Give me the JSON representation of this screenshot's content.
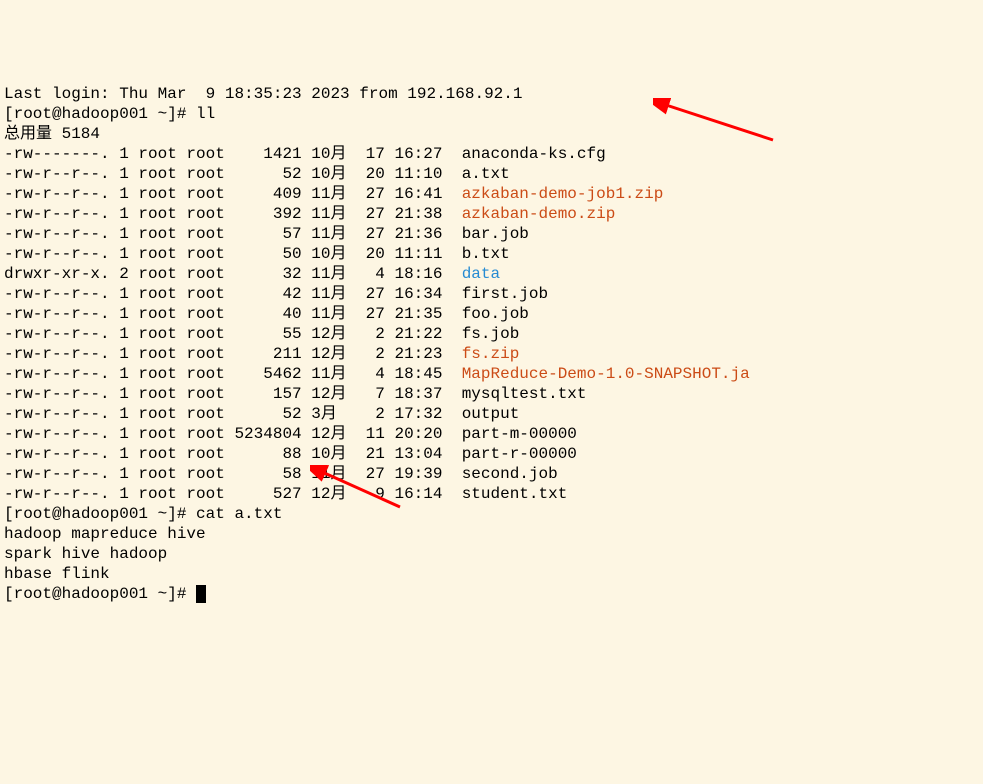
{
  "login_line": "Last login: Thu Mar  9 18:35:23 2023 from 192.168.92.1",
  "prompt1": "[root@hadoop001 ~]# ",
  "cmd1": "ll",
  "total_line": "总用量 5184",
  "files": [
    {
      "perms": "-rw-------.",
      "links": "1",
      "owner": "root",
      "group": "root",
      "size": "   1421",
      "month": "10月",
      "day": " 17",
      "time": "16:27",
      "name": "anaconda-ks.cfg",
      "color": ""
    },
    {
      "perms": "-rw-r--r--.",
      "links": "1",
      "owner": "root",
      "group": "root",
      "size": "     52",
      "month": "10月",
      "day": " 20",
      "time": "11:10",
      "name": "a.txt",
      "color": ""
    },
    {
      "perms": "-rw-r--r--.",
      "links": "1",
      "owner": "root",
      "group": "root",
      "size": "    409",
      "month": "11月",
      "day": " 27",
      "time": "16:41",
      "name": "azkaban-demo-job1.zip",
      "color": "red"
    },
    {
      "perms": "-rw-r--r--.",
      "links": "1",
      "owner": "root",
      "group": "root",
      "size": "    392",
      "month": "11月",
      "day": " 27",
      "time": "21:38",
      "name": "azkaban-demo.zip",
      "color": "red"
    },
    {
      "perms": "-rw-r--r--.",
      "links": "1",
      "owner": "root",
      "group": "root",
      "size": "     57",
      "month": "11月",
      "day": " 27",
      "time": "21:36",
      "name": "bar.job",
      "color": ""
    },
    {
      "perms": "-rw-r--r--.",
      "links": "1",
      "owner": "root",
      "group": "root",
      "size": "     50",
      "month": "10月",
      "day": " 20",
      "time": "11:11",
      "name": "b.txt",
      "color": ""
    },
    {
      "perms": "drwxr-xr-x.",
      "links": "2",
      "owner": "root",
      "group": "root",
      "size": "     32",
      "month": "11月",
      "day": "  4",
      "time": "18:16",
      "name": "data",
      "color": "blue"
    },
    {
      "perms": "-rw-r--r--.",
      "links": "1",
      "owner": "root",
      "group": "root",
      "size": "     42",
      "month": "11月",
      "day": " 27",
      "time": "16:34",
      "name": "first.job",
      "color": ""
    },
    {
      "perms": "-rw-r--r--.",
      "links": "1",
      "owner": "root",
      "group": "root",
      "size": "     40",
      "month": "11月",
      "day": " 27",
      "time": "21:35",
      "name": "foo.job",
      "color": ""
    },
    {
      "perms": "-rw-r--r--.",
      "links": "1",
      "owner": "root",
      "group": "root",
      "size": "     55",
      "month": "12月",
      "day": "  2",
      "time": "21:22",
      "name": "fs.job",
      "color": ""
    },
    {
      "perms": "-rw-r--r--.",
      "links": "1",
      "owner": "root",
      "group": "root",
      "size": "    211",
      "month": "12月",
      "day": "  2",
      "time": "21:23",
      "name": "fs.zip",
      "color": "red"
    },
    {
      "perms": "-rw-r--r--.",
      "links": "1",
      "owner": "root",
      "group": "root",
      "size": "   5462",
      "month": "11月",
      "day": "  4",
      "time": "18:45",
      "name": "MapReduce-Demo-1.0-SNAPSHOT.ja",
      "color": "red"
    },
    {
      "perms": "-rw-r--r--.",
      "links": "1",
      "owner": "root",
      "group": "root",
      "size": "    157",
      "month": "12月",
      "day": "  7",
      "time": "18:37",
      "name": "mysqltest.txt",
      "color": ""
    },
    {
      "perms": "-rw-r--r--.",
      "links": "1",
      "owner": "root",
      "group": "root",
      "size": "     52",
      "month": "3月 ",
      "day": "  2",
      "time": "17:32",
      "name": "output",
      "color": ""
    },
    {
      "perms": "-rw-r--r--.",
      "links": "1",
      "owner": "root",
      "group": "root",
      "size": "5234804",
      "month": "12月",
      "day": " 11",
      "time": "20:20",
      "name": "part-m-00000",
      "color": ""
    },
    {
      "perms": "-rw-r--r--.",
      "links": "1",
      "owner": "root",
      "group": "root",
      "size": "     88",
      "month": "10月",
      "day": " 21",
      "time": "13:04",
      "name": "part-r-00000",
      "color": ""
    },
    {
      "perms": "-rw-r--r--.",
      "links": "1",
      "owner": "root",
      "group": "root",
      "size": "     58",
      "month": "11月",
      "day": " 27",
      "time": "19:39",
      "name": "second.job",
      "color": ""
    },
    {
      "perms": "-rw-r--r--.",
      "links": "1",
      "owner": "root",
      "group": "root",
      "size": "    527",
      "month": "12月",
      "day": "  9",
      "time": "16:14",
      "name": "student.txt",
      "color": ""
    }
  ],
  "prompt2": "[root@hadoop001 ~]# ",
  "cmd2": "cat a.txt",
  "cat_output": [
    "hadoop mapreduce hive",
    "spark hive hadoop",
    "hbase flink"
  ],
  "prompt3": "[root@hadoop001 ~]# "
}
